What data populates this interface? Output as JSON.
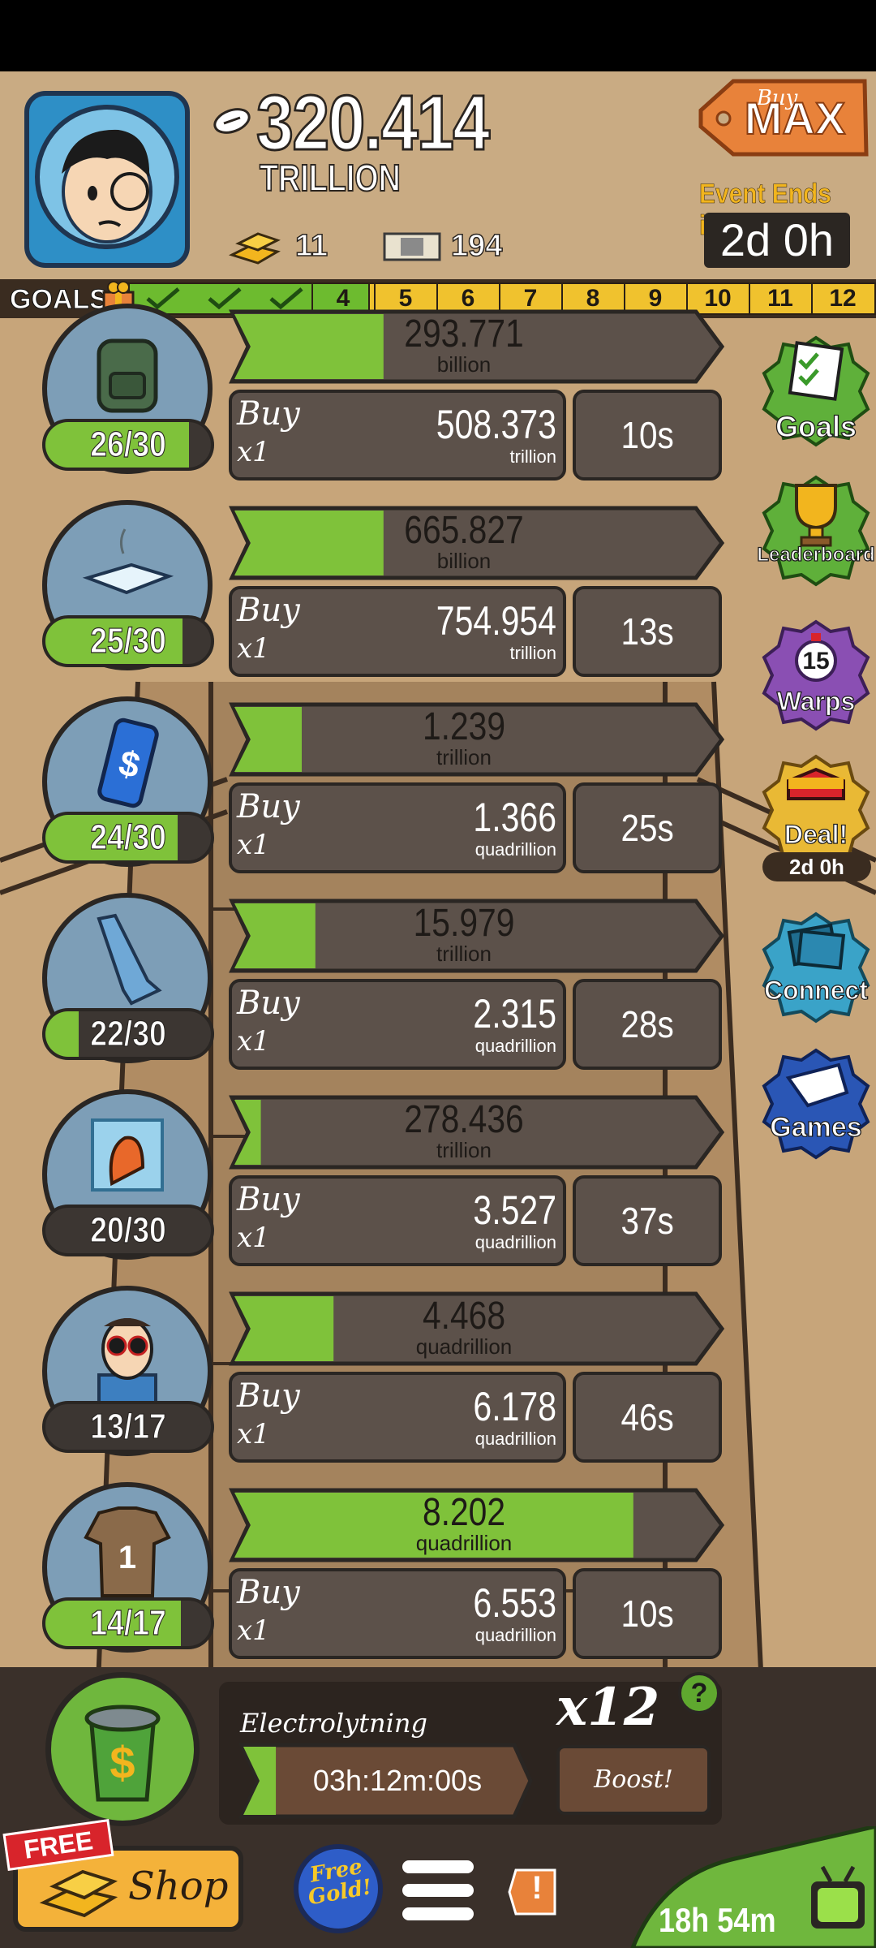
{
  "colors": {
    "progress_green": "#7fc23a",
    "bar_gray": "#5c514a",
    "accent_orange": "#e8823a",
    "gold": "#f2b51e"
  },
  "header": {
    "cash_amount": "320.414",
    "cash_unit": "TRILLION",
    "gold_count": "11",
    "bill_count": "194",
    "buy_max_top": "Buy",
    "buy_max_label": "MAX",
    "event_label": "Event Ends in:",
    "event_time": "2d 0h",
    "icons": [
      "football-icon",
      "gold-bars-icon",
      "dollar-bill-icon",
      "astronaut-avatar"
    ]
  },
  "goals": {
    "label": "GOALS",
    "completed": 3,
    "numbers": [
      "4",
      "5",
      "6",
      "7",
      "8",
      "9",
      "10",
      "11",
      "12"
    ]
  },
  "businesses": [
    {
      "icon": "backpack-icon",
      "owned": "26/30",
      "owned_fraction": 0.87,
      "progress_value": "293.771",
      "progress_unit": "billion",
      "progress_fraction": 0.33,
      "buy_label": "Buy",
      "buy_mult": "x1",
      "cost": "508.373",
      "cost_unit": "trillion",
      "timer": "10s"
    },
    {
      "icon": "towel-icon",
      "owned": "25/30",
      "owned_fraction": 0.83,
      "progress_value": "665.827",
      "progress_unit": "billion",
      "progress_fraction": 0.33,
      "buy_label": "Buy",
      "buy_mult": "x1",
      "cost": "754.954",
      "cost_unit": "trillion",
      "timer": "13s"
    },
    {
      "icon": "soda-can-icon",
      "owned": "24/30",
      "owned_fraction": 0.8,
      "progress_value": "1.239",
      "progress_unit": "trillion",
      "progress_fraction": 0.15,
      "buy_label": "Buy",
      "buy_mult": "x1",
      "cost": "1.366",
      "cost_unit": "quadrillion",
      "timer": "25s"
    },
    {
      "icon": "foam-finger-icon",
      "owned": "22/30",
      "owned_fraction": 0.2,
      "progress_value": "15.979",
      "progress_unit": "trillion",
      "progress_fraction": 0.18,
      "buy_label": "Buy",
      "buy_mult": "x1",
      "cost": "2.315",
      "cost_unit": "quadrillion",
      "timer": "28s"
    },
    {
      "icon": "frozen-chair-icon",
      "owned": "20/30",
      "owned_fraction": 0.0,
      "progress_value": "278.436",
      "progress_unit": "trillion",
      "progress_fraction": 0.06,
      "buy_label": "Buy",
      "buy_mult": "x1",
      "cost": "3.527",
      "cost_unit": "quadrillion",
      "timer": "37s"
    },
    {
      "icon": "sunglasses-man-icon",
      "owned": "13/17",
      "owned_fraction": 0.0,
      "progress_value": "4.468",
      "progress_unit": "quadrillion",
      "progress_fraction": 0.22,
      "buy_label": "Buy",
      "buy_mult": "x1",
      "cost": "6.178",
      "cost_unit": "quadrillion",
      "timer": "46s"
    },
    {
      "icon": "jersey-icon",
      "owned": "14/17",
      "owned_fraction": 0.82,
      "progress_value": "8.202",
      "progress_unit": "quadrillion",
      "progress_fraction": 0.88,
      "buy_label": "Buy",
      "buy_mult": "x1",
      "cost": "6.553",
      "cost_unit": "quadrillion",
      "timer": "10s"
    }
  ],
  "sidebar": {
    "goals": "Goals",
    "leaderboard": "Leaderboard",
    "warps_count": "15",
    "warps": "Warps",
    "deal": "Deal!",
    "deal_timer": "2d 0h",
    "connect": "Connect",
    "games": "Games"
  },
  "boost": {
    "name": "Electrolytning",
    "multiplier": "x12",
    "help": "?",
    "time": "03h:12m:00s",
    "progress_fraction": 0.12,
    "button": "Boost!"
  },
  "bottom_nav": {
    "free_label": "FREE",
    "shop_label": "Shop",
    "free_gold_label": "Free Gold!",
    "alert": "!",
    "tv_time": "18h 54m"
  }
}
